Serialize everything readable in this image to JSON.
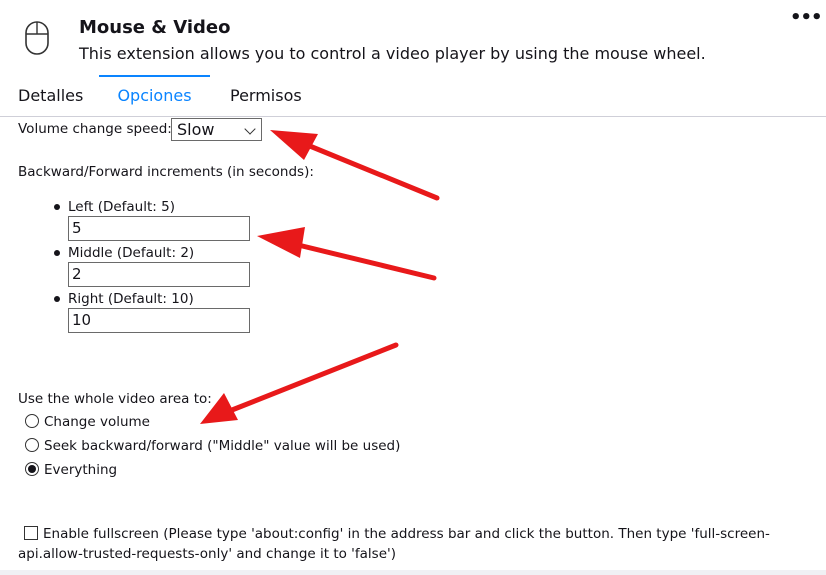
{
  "extension": {
    "title": "Mouse & Video",
    "description": "This extension allows you to control a video player by using the mouse wheel.",
    "icon": "mouse-icon",
    "more_label": "•••"
  },
  "tabs": [
    {
      "label": "Detalles",
      "active": false
    },
    {
      "label": "Opciones",
      "active": true
    },
    {
      "label": "Permisos",
      "active": false
    }
  ],
  "options": {
    "volume_speed_label": "Volume change speed:",
    "volume_speed_value": "Slow",
    "increments_label": "Backward/Forward increments (in seconds):",
    "increments": [
      {
        "label": "Left (Default: 5)",
        "value": "5"
      },
      {
        "label": "Middle (Default: 2)",
        "value": "2"
      },
      {
        "label": "Right (Default: 10)",
        "value": "10"
      }
    ],
    "video_area_label": "Use the whole video area to:",
    "video_area_options": [
      {
        "label": "Change volume",
        "checked": false
      },
      {
        "label": "Seek backward/forward (\"Middle\" value will be used)",
        "checked": false
      },
      {
        "label": "Everything",
        "checked": true
      }
    ],
    "fullscreen_label": "Enable fullscreen (Please type 'about:config' in the address bar and click the button. Then type 'full-screen-api.allow-trusted-requests-only' and change it to 'false')",
    "fullscreen_checked": false
  },
  "colors": {
    "accent": "#0a84ff",
    "annotation_arrow": "#e8191a"
  }
}
